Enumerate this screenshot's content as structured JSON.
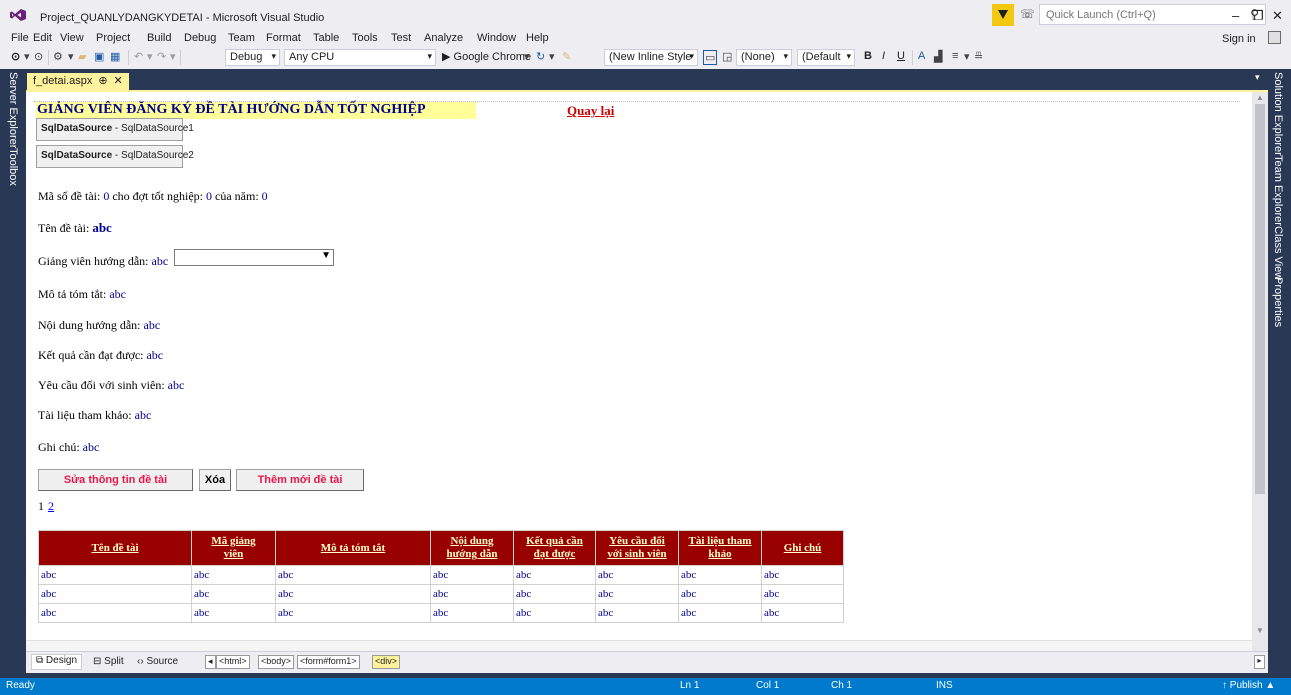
{
  "window": {
    "title": "Project_QUANLYDANGKYDETAI - Microsoft Visual Studio",
    "quick_launch_placeholder": "Quick Launch (Ctrl+Q)",
    "minimize": "–",
    "restore": "❐",
    "close": "✕"
  },
  "menu": [
    "File",
    "Edit",
    "View",
    "Project",
    "Build",
    "Debug",
    "Team",
    "Format",
    "Table",
    "Tools",
    "Test",
    "Analyze",
    "Window",
    "Help"
  ],
  "signin": "Sign in",
  "toolbar": {
    "config": "Debug",
    "platform": "Any CPU",
    "run_target": "▶ Google Chrome",
    "style": "(New Inline Style",
    "target_rule": "(None)",
    "font": "(Default",
    "bold": "B",
    "italic": "I",
    "underline": "U"
  },
  "side_tabs_left": [
    "Server Explorer",
    "Toolbox"
  ],
  "side_tabs_right": [
    "Solution Explorer",
    "Team Explorer",
    "Class View",
    "Properties"
  ],
  "doc_tab": {
    "name": "f_detai.aspx",
    "pin": "⊕",
    "close": "✕"
  },
  "page": {
    "title": "GIẢNG VIÊN ĐĂNG KÝ ĐỀ TÀI HƯỚNG DẪN TỐT NGHIỆP",
    "back": "Quay lại",
    "datasources": [
      {
        "type": "SqlDataSource",
        "name": " - SqlDataSource1"
      },
      {
        "type": "SqlDataSource",
        "name": " - SqlDataSource2"
      }
    ],
    "info_line": {
      "l1": "Mã số đề tài: ",
      "v1": "0",
      "l2": "  cho đợt tốt nghiệp: ",
      "v2": "0",
      "l3": "  của năm: ",
      "v3": "0"
    },
    "fields": {
      "ten_label": "Tên đề tài: ",
      "ten_value": "abc",
      "gv_label": "Giảng viên hướng dẫn: ",
      "gv_value": "abc",
      "mota_label": "Mô tả tóm tắt: ",
      "mota_value": "abc",
      "noidung_label": "Nội dung hướng dẫn: ",
      "noidung_value": "abc",
      "ketqua_label": "Kết quả cần đạt được: ",
      "ketqua_value": "abc",
      "yeucau_label": "Yêu cầu đối với sinh viên: ",
      "yeucau_value": "abc",
      "tailieu_label": "Tài liệu tham khảo: ",
      "tailieu_value": "abc",
      "ghichu_label": "Ghi chú: ",
      "ghichu_value": "abc"
    },
    "buttons": {
      "edit": "Sửa thông tin đề tài",
      "delete": "Xóa",
      "add": "Thêm mới đề tài"
    },
    "pager": {
      "current": "1",
      "next": "2"
    },
    "grid": {
      "headers": [
        {
          "l1": "Tên đề tài",
          "l2": ""
        },
        {
          "l1": "Mã giảng",
          "l2": "viên"
        },
        {
          "l1": "Mô tả tóm tắt",
          "l2": ""
        },
        {
          "l1": "Nội dung",
          "l2": "hướng dẫn"
        },
        {
          "l1": "Kết quả cần",
          "l2": "đạt được"
        },
        {
          "l1": "Yêu cầu đối",
          "l2": "với sinh viên"
        },
        {
          "l1": "Tài liệu tham",
          "l2": "khảo"
        },
        {
          "l1": "Ghi chú",
          "l2": ""
        }
      ],
      "rows": [
        [
          "abc",
          "abc",
          "abc",
          "abc",
          "abc",
          "abc",
          "abc",
          "abc"
        ],
        [
          "abc",
          "abc",
          "abc",
          "abc",
          "abc",
          "abc",
          "abc",
          "abc"
        ],
        [
          "abc",
          "abc",
          "abc",
          "abc",
          "abc",
          "abc",
          "abc",
          "abc"
        ]
      ]
    }
  },
  "viewbar": {
    "design": "⧉ Design",
    "split": "⊟ Split",
    "source": "‹› Source",
    "crumbs": [
      "<html>",
      "<body>",
      "<form#form1>",
      "<div>"
    ]
  },
  "status": {
    "ready": "Ready",
    "ln": "Ln 1",
    "col": "Col 1",
    "ch": "Ch 1",
    "ins": "INS",
    "publish": "↑ Publish ▲"
  }
}
